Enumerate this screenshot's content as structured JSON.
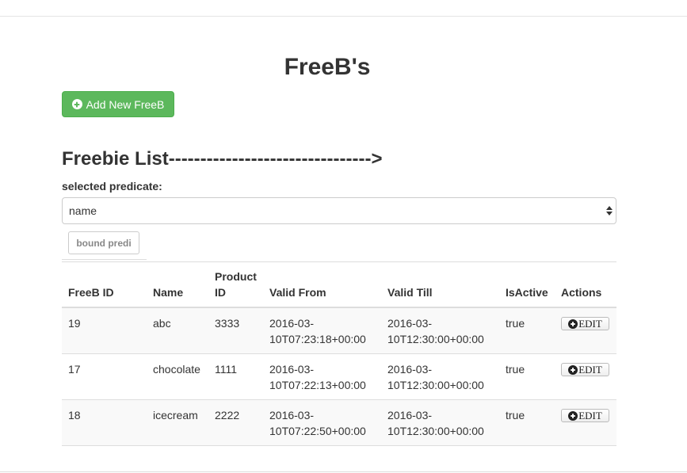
{
  "page": {
    "title": "FreeB's"
  },
  "add_button": {
    "label": "Add New FreeB",
    "icon": "plus-circle-icon",
    "color": "#5cb85c"
  },
  "list": {
    "heading": "Freebie List-------------------------------->",
    "predicate_label": "selected predicate:",
    "predicate_value": "name",
    "bound_button_label": "bound predi"
  },
  "table": {
    "headers": [
      "FreeB ID",
      "Name",
      "Product ID",
      "Valid From",
      "Valid Till",
      "IsActive",
      "Actions"
    ],
    "rows": [
      {
        "id": "19",
        "name": "abc",
        "product_id": "3333",
        "valid_from": "2016-03-10T07:23:18+00:00",
        "valid_till": "2016-03-10T12:30:00+00:00",
        "is_active": "true",
        "action_label": "EDIT"
      },
      {
        "id": "17",
        "name": "chocolate",
        "product_id": "1111",
        "valid_from": "2016-03-10T07:22:13+00:00",
        "valid_till": "2016-03-10T12:30:00+00:00",
        "is_active": "true",
        "action_label": "EDIT"
      },
      {
        "id": "18",
        "name": "icecream",
        "product_id": "2222",
        "valid_from": "2016-03-10T07:22:50+00:00",
        "valid_till": "2016-03-10T12:30:00+00:00",
        "is_active": "true",
        "action_label": "EDIT"
      }
    ]
  }
}
